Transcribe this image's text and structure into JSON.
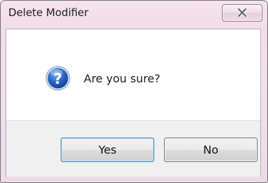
{
  "window": {
    "title": "Delete Modifier",
    "close_icon": "close-icon"
  },
  "message": {
    "icon": "question-icon",
    "text": "Are you sure?"
  },
  "buttons": {
    "yes_label": "Yes",
    "no_label": "No"
  },
  "colors": {
    "frame": "#f3dde8",
    "icon_blue": "#2a5fb7",
    "focus_border": "#3c7fb1"
  }
}
